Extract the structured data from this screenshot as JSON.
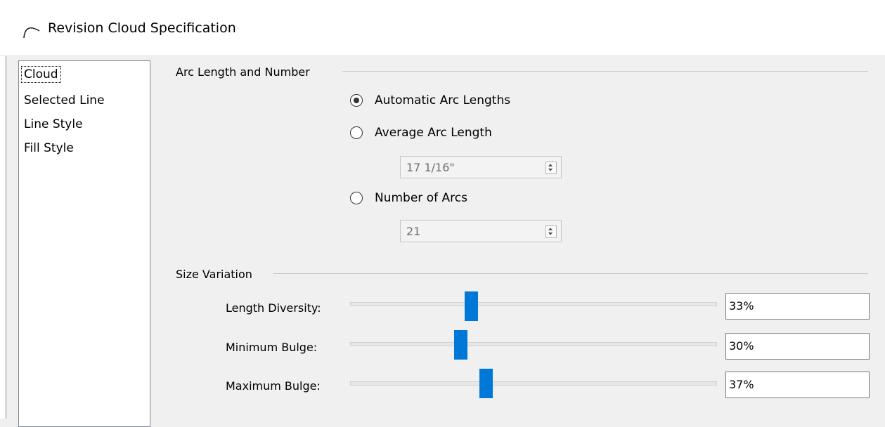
{
  "window": {
    "title": "Revision Cloud Specification",
    "icon": "arc-icon"
  },
  "nav": {
    "items": [
      {
        "label": "Cloud",
        "selected": true
      },
      {
        "label": "Selected Line"
      },
      {
        "label": "Line Style"
      },
      {
        "label": "Fill Style"
      }
    ]
  },
  "arc_section": {
    "title": "Arc Length and Number",
    "options": [
      {
        "label": "Automatic Arc Lengths",
        "checked": true
      },
      {
        "label": "Average Arc Length",
        "checked": false
      },
      {
        "label": "Number of Arcs",
        "checked": false
      }
    ],
    "average_arc_length_value": "17 1/16\"",
    "number_of_arcs_value": "21"
  },
  "size_section": {
    "title": "Size Variation",
    "sliders": [
      {
        "label": "Length Diversity:",
        "value_text": "33%",
        "fraction": 0.33
      },
      {
        "label": "Minimum Bulge:",
        "value_text": "30%",
        "fraction": 0.3
      },
      {
        "label": "Maximum Bulge:",
        "value_text": "37%",
        "fraction": 0.37
      }
    ]
  },
  "colors": {
    "accent": "#0078d7",
    "background": "#f0f0f0"
  }
}
